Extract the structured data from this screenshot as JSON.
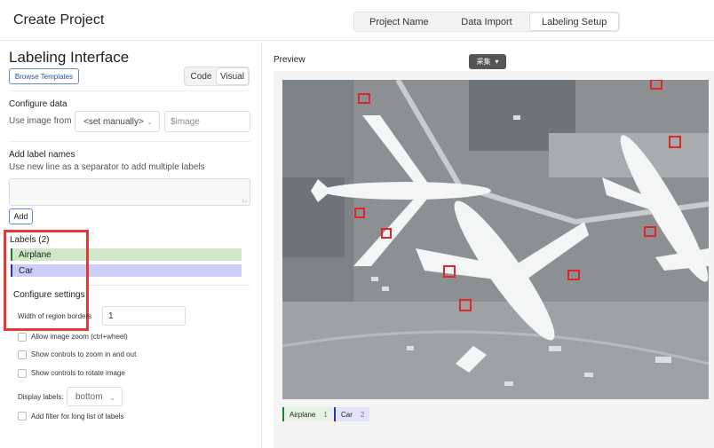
{
  "header": {
    "title": "Create Project",
    "steps": [
      "Project Name",
      "Data Import",
      "Labeling Setup"
    ],
    "active_step": "Labeling Setup"
  },
  "labeling_interface": {
    "title": "Labeling Interface",
    "browse_templates": "Browse Templates",
    "view_toggle": {
      "code": "Code",
      "visual": "Visual",
      "active": "Visual"
    }
  },
  "configure_data": {
    "title": "Configure data",
    "use_image_from": "Use image from",
    "source_select": "<set manually>",
    "value_field": "$image"
  },
  "add_labels": {
    "title": "Add label names",
    "hint": "Use new line as a separator to add multiple labels",
    "textarea_value": "",
    "add_button": "Add"
  },
  "labels": {
    "title": "Labels (2)",
    "items": [
      {
        "name": "Airplane",
        "color": "#1e7d32",
        "bg": "#cfe8c8"
      },
      {
        "name": "Car",
        "color": "#2d2dbf",
        "bg": "#cdcdf7"
      }
    ]
  },
  "configure_settings": {
    "title": "Configure settings",
    "border_width_label": "Width of region borders",
    "border_width_value": "1",
    "options": [
      {
        "label": "Allow image zoom (ctrl+wheel)",
        "checked": false
      },
      {
        "label": "Show controls to zoom in and out",
        "checked": false
      },
      {
        "label": "Show controls to rotate image",
        "checked": false
      }
    ],
    "display_labels_label": "Display labels:",
    "display_labels_value": "bottom",
    "filter_option": {
      "label": "Add filter for long list of labels",
      "checked": false
    }
  },
  "preview": {
    "title": "Preview",
    "language_button": "采集",
    "chips": [
      {
        "name": "Airplane",
        "hotkey": "1",
        "color": "#1e7d32",
        "bg": "#cfe8c8"
      },
      {
        "name": "Car",
        "hotkey": "2",
        "color": "#2d2dbf",
        "bg": "#cdcdf7"
      }
    ]
  },
  "colors": {
    "highlight": "#e53935",
    "accent": "#6a8ac8"
  }
}
